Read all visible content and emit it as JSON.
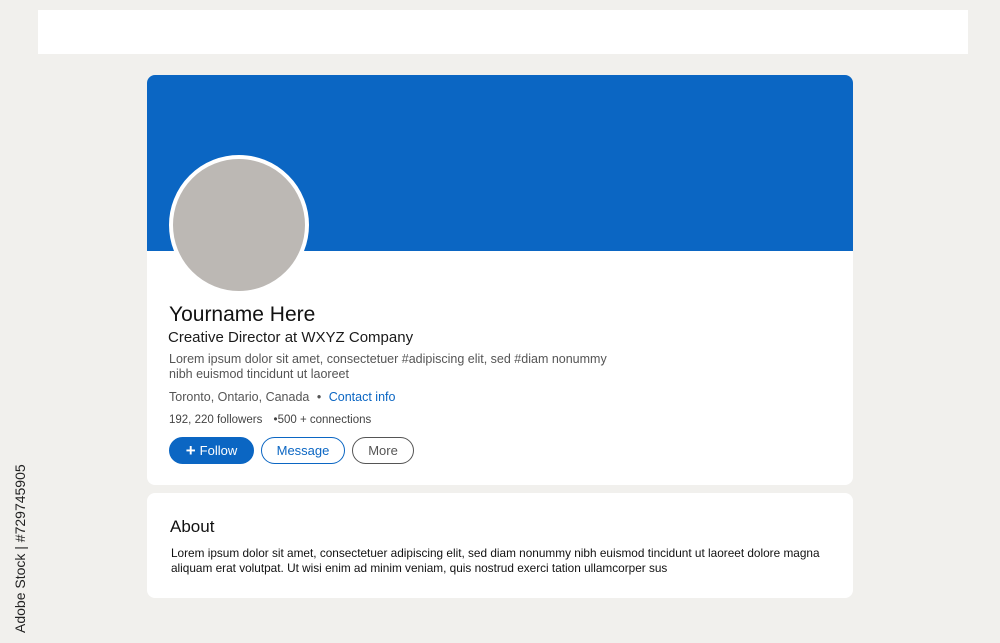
{
  "profile": {
    "name": "Yourname Here",
    "headline": "Creative Director at WXYZ Company",
    "bio": "Lorem ipsum dolor sit amet, consectetuer #adipiscing elit, sed #diam nonummy nibh euismod tincidunt ut laoreet",
    "location": "Toronto, Ontario, Canada",
    "location_separator": "•",
    "contact_link": "Contact info",
    "followers": "192, 220 followers",
    "connections": "•500 + connections"
  },
  "actions": {
    "follow_icon": "+",
    "follow_label": "Follow",
    "message_label": "Message",
    "more_label": "More"
  },
  "about": {
    "title": "About",
    "text": "Lorem ipsum dolor sit amet, consectetuer adipiscing elit, sed diam nonummy nibh euismod tincidunt ut laoreet dolore magna aliquam erat volutpat. Ut wisi enim ad minim veniam, quis nostrud exerci tation ullamcorper sus"
  },
  "watermark": {
    "side_text": "Adobe Stock | #729745905"
  },
  "colors": {
    "brand_blue": "#0b66c3",
    "avatar_placeholder": "#bcb8b4",
    "page_background": "#f1f0ed"
  }
}
